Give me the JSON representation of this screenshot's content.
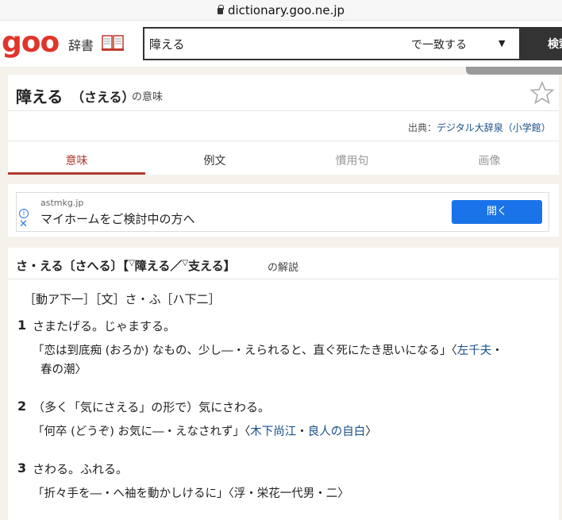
{
  "browser": {
    "url": "dictionary.goo.ne.jp"
  },
  "header": {
    "logo": "goo",
    "dict_label": "辞書",
    "search": {
      "value": "障える",
      "match_mode": "で一致する",
      "button_label": "検索"
    }
  },
  "entry": {
    "title_word": "障える",
    "title_reading": "（さえる）",
    "title_suffix": "の意味",
    "source_label": "出典：",
    "source_link": "デジタル大辞泉（小学館）",
    "tabs": [
      "意味",
      "例文",
      "慣用句",
      "画像"
    ]
  },
  "ad": {
    "domain": "astmkg.jp",
    "text": "マイホームをご検討中の方へ",
    "button_label": "開く"
  },
  "definition": {
    "headword_prefix": "さ・える〔さへる〕【",
    "mark": "▽",
    "kanji_1": "障える",
    "separator": "／",
    "kanji_2": "支える",
    "headword_close": "】",
    "suffix": "の解説",
    "grammar": "［動ア下一］［文］さ・ふ［ハ下二］",
    "senses": [
      {
        "num": "1",
        "text": "さまたげる。じゃまする。",
        "example_text": "「恋は到底痴 (おろか) なもの、少し―・えられると、直ぐ死にたき思いになる」〈",
        "cite_1": "左千夫",
        "cite_sep": "・",
        "cite_2": "",
        "example_tail": "春の潮〉"
      },
      {
        "num": "2",
        "text": "（多く「気にさえる」の形で）気にさわる。",
        "example_text": "「何卒 (どうぞ) お気に―・えなされず」〈",
        "cite_1": "木下尚江",
        "cite_sep": "・",
        "cite_2": "良人の自白",
        "example_tail": "〉"
      },
      {
        "num": "3",
        "text": "さわる。ふれる。",
        "example_text": "「折々手を―・へ袖を動かしけるに」〈浮・栄花一代男・二〉"
      }
    ]
  },
  "colors": {
    "brand_red": "#e0352b",
    "accent_tab": "#b23a2e",
    "link_blue": "#1a4f8a",
    "ad_button": "#1a73e8"
  }
}
